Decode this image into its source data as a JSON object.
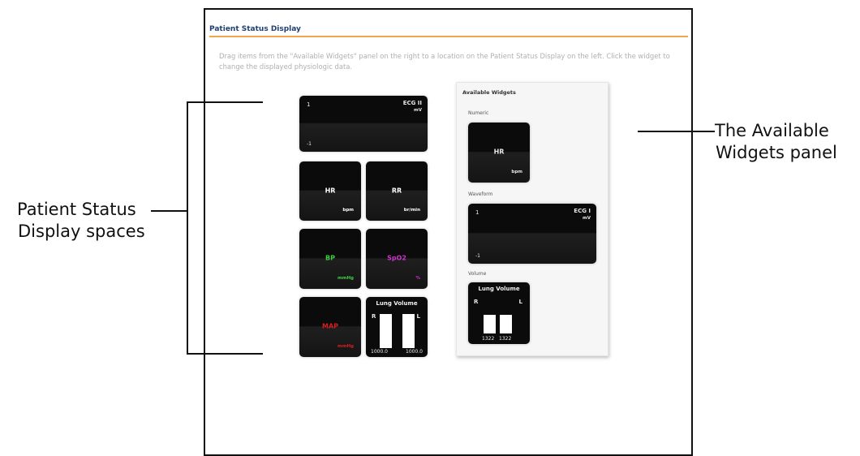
{
  "title": "Patient Status Display",
  "intro": "Drag items from the \"Available Widgets\" panel on the right to a location on the Patient Status Display on the left. Click the widget to change the displayed physiologic data.",
  "display": {
    "ecg": {
      "label": "ECG II",
      "unit": "mV",
      "top_value": "1",
      "bottom_value": "-1"
    },
    "hr": {
      "label": "HR",
      "unit": "bpm",
      "color": "#ffffff"
    },
    "rr": {
      "label": "RR",
      "unit": "br/min",
      "color": "#ffffff"
    },
    "bp": {
      "label": "BP",
      "unit": "mmHg",
      "color": "#3fcf3f"
    },
    "spo2": {
      "label": "SpO2",
      "unit": "%",
      "color": "#cc33cc"
    },
    "map": {
      "label": "MAP",
      "unit": "mmHg",
      "color": "#d81e1e"
    },
    "lung": {
      "title": "Lung Volume",
      "right_label": "R",
      "left_label": "L",
      "right_value": "1000.0",
      "left_value": "1000.0"
    }
  },
  "panel": {
    "title": "Available Widgets",
    "numeric_label": "Numeric",
    "numeric": {
      "label": "HR",
      "unit": "bpm"
    },
    "waveform_label": "Waveform",
    "waveform": {
      "label": "ECG I",
      "unit": "mV",
      "top_value": "1",
      "bottom_value": "-1"
    },
    "volume_label": "Volume",
    "volume": {
      "title": "Lung Volume",
      "right_label": "R",
      "left_label": "L",
      "right_value": "1322",
      "left_value": "1322"
    }
  },
  "annotations": {
    "left_line1": "Patient Status",
    "left_line2": "Display spaces",
    "right_line1": "The Available",
    "right_line2": "Widgets panel"
  }
}
